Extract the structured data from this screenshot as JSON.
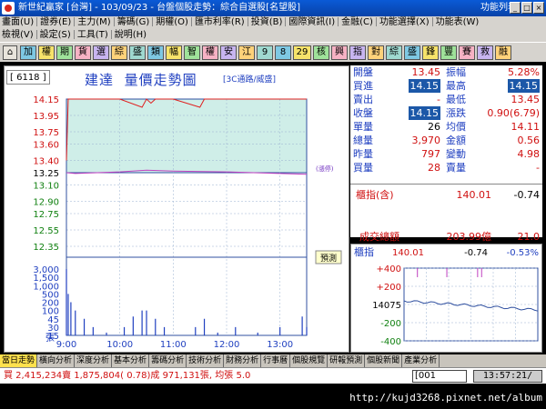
{
  "titlebar": {
    "title": "新世紀贏家 [台灣] - 103/09/23 - 台盤個股走勢：綜合自選股[名望股]",
    "function_list": "功能列表",
    "min_label": "_",
    "max_label": "□",
    "close_label": "×"
  },
  "menubar": {
    "row1": [
      "畫面(U)",
      "證券(E)",
      "主力(M)",
      "籌碼(G)",
      "期權(O)",
      "匯市利率(R)",
      "投資(B)",
      "國際資訊(I)",
      "金融(C)",
      "功能選擇(X)",
      "功能表(W)"
    ],
    "row2": [
      "檢視(V)",
      "設定(S)",
      "工具(T)",
      "說明(H)"
    ]
  },
  "toolbar": {
    "buttons": [
      "加",
      "權",
      "期",
      "貨",
      "選",
      "綜",
      "盛",
      "類",
      "幅",
      "智",
      "權",
      "安",
      "江",
      "9",
      "8",
      "29",
      "核",
      "興",
      "指",
      "對",
      "綜",
      "盛",
      "鋒",
      "豐",
      "賽",
      "救",
      "融"
    ]
  },
  "chart": {
    "code": "6118",
    "stock_name": "建達",
    "title": "量價走勢圖",
    "category": "[3C通路/威盛]",
    "limit_label": "(漲停)",
    "box_label": "預測",
    "volume_unit": "張"
  },
  "chart_data": {
    "type": "line",
    "title": "建達 量價走勢圖",
    "x_ticks": [
      "9:00",
      "10:00",
      "11:00",
      "12:00",
      "13:00"
    ],
    "price_ticks": [
      "14.15",
      "13.95",
      "13.75",
      "13.60",
      "13.40",
      "13.25",
      "13.10",
      "12.90",
      "12.75",
      "12.55",
      "12.35"
    ],
    "volume_ticks": [
      "3,000",
      "1,500",
      "1,000",
      "500",
      "200",
      "100",
      "45",
      "30",
      "15"
    ],
    "reference_price": 13.25,
    "limit_up": 14.15,
    "limit_down": 12.35,
    "price_series": {
      "name": "成交價",
      "x": [
        "09:00",
        "09:02",
        "09:05",
        "09:30",
        "10:00",
        "10:25",
        "10:30",
        "10:35",
        "10:40",
        "11:00",
        "11:30",
        "11:35",
        "11:40",
        "12:00",
        "12:30",
        "13:00",
        "13:30"
      ],
      "values": [
        13.4,
        14.15,
        14.15,
        14.15,
        14.15,
        14.05,
        14.15,
        14.1,
        14.15,
        14.15,
        14.05,
        14.15,
        14.15,
        14.15,
        14.15,
        14.15,
        14.15
      ]
    },
    "avg_series": {
      "name": "均價",
      "x": [
        "09:00",
        "09:10",
        "10:00",
        "10:30",
        "11:00",
        "12:00",
        "13:00",
        "13:30"
      ],
      "values": [
        13.25,
        13.24,
        13.26,
        13.28,
        13.27,
        13.26,
        13.24,
        13.23
      ]
    },
    "volume_series": {
      "name": "成交量",
      "x": [
        "09:00",
        "09:02",
        "09:05",
        "09:10",
        "09:20",
        "09:30",
        "09:45",
        "10:00",
        "10:05",
        "10:15",
        "10:25",
        "10:30",
        "10:40",
        "10:50",
        "11:00",
        "11:10",
        "11:25",
        "11:35",
        "11:50",
        "12:00",
        "12:10",
        "12:25",
        "12:35",
        "12:45",
        "13:00",
        "13:15",
        "13:25",
        "13:30"
      ],
      "values": [
        3000,
        500,
        200,
        100,
        45,
        30,
        20,
        15,
        30,
        60,
        100,
        100,
        45,
        30,
        15,
        15,
        30,
        45,
        20,
        15,
        30,
        15,
        20,
        15,
        30,
        15,
        60,
        30
      ]
    }
  },
  "quote": {
    "open_label": "開盤",
    "open": "13.45",
    "amplitude_label": "振幅",
    "amplitude": "5.28%",
    "bid_label": "買進",
    "bid": "14.15",
    "high_label": "最高",
    "high": "14.15",
    "ask_label": "賣出",
    "ask": "-",
    "low_label": "最低",
    "low": "13.45",
    "close_label": "收盤",
    "close": "14.15",
    "change_label": "漲跌",
    "change": "0.90(6.79)",
    "single_vol_label": "單量",
    "single_vol": "26",
    "avg_label": "均價",
    "avg": "14.11",
    "total_vol_label": "總量",
    "total_vol": "3,970",
    "amount_label": "金額",
    "amount": "0.56",
    "yesterday_label": "昨量",
    "yesterday": "797",
    "turnover_label": "變動",
    "turnover": "4.98",
    "buy_vol_label": "買量",
    "buy_vol": "28",
    "sell_vol_label": "賣量",
    "sell_vol": "-",
    "index_label": "櫃指(含)",
    "index_value": "140.01",
    "index_change": "-0.74",
    "deal_total_label": "成交總額",
    "deal_total": "203.99億",
    "deal_total_2": "21.0"
  },
  "mini": {
    "label": "櫃指",
    "value": "140.01",
    "change": "-0.74",
    "pct": "-0.53%",
    "ticks": [
      "+400",
      "+200",
      "14075",
      "-200",
      "-400"
    ]
  },
  "tabs": [
    "當日走勢",
    "橫向分析",
    "深度分析",
    "基本分析",
    "籌碼分析",
    "技術分析",
    "財務分析",
    "行事曆",
    "個股規覽",
    "研報預測",
    "個股新聞",
    "產業分析"
  ],
  "status": {
    "text": "買 2,415,234賣 1,875,804( 0.78)成 971,131張, 均張 5.0",
    "code": "001",
    "time": "13:57:21/"
  },
  "watermark": "http://kujd3268.pixnet.net/album"
}
